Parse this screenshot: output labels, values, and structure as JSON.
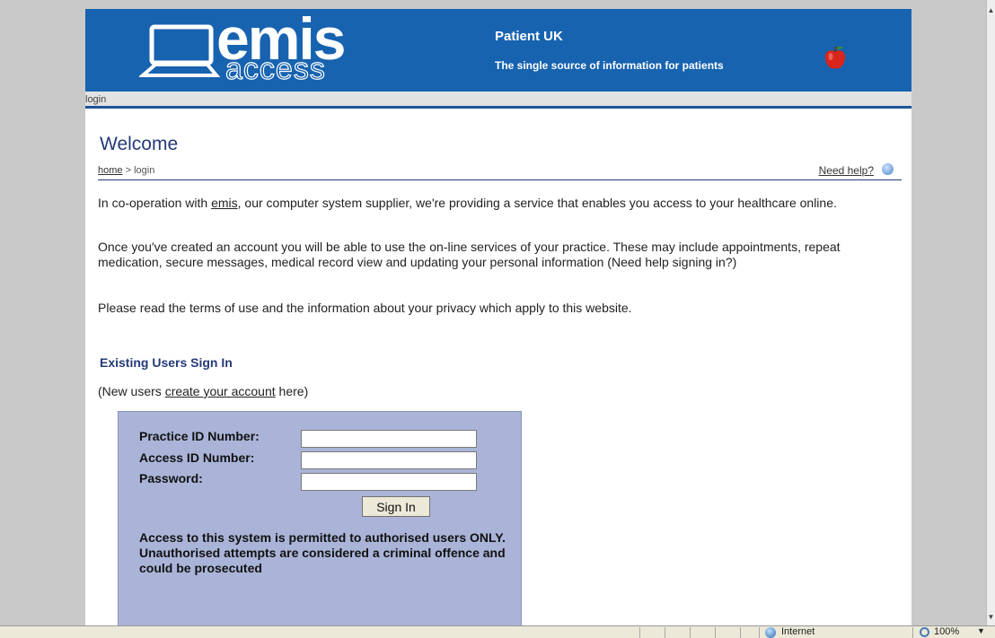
{
  "banner": {
    "logo_word": "emis",
    "logo_sub": "access",
    "site_name": "Patient UK",
    "tagline": "The single source of information for patients"
  },
  "navbar": {
    "label": "login"
  },
  "content": {
    "heading": "Welcome",
    "breadcrumb": {
      "home": "home",
      "sep": " > ",
      "current": "login"
    },
    "help_link": "Need help?",
    "para1": {
      "before": "In co-operation with ",
      "link": "emis",
      "after": ", our computer system supplier, we're providing a service that enables you access to your healthcare online."
    },
    "para2": "Once you've created an account you will be able to use the on-line services of your practice. These may include appointments, repeat medication, secure messages, medical record view and updating your personal information (Need help signing in?)",
    "para3": "Please read the terms of use and the information about your privacy which apply to this website.",
    "section_title": "Existing Users Sign In",
    "new_users": {
      "before": "(New users ",
      "link": "create your account",
      "after": " here)"
    }
  },
  "login_form": {
    "practice_id_label": "Practice ID Number:",
    "access_id_label": "Access ID Number:",
    "password_label": "Password:",
    "practice_id_value": "",
    "access_id_value": "",
    "password_value": "",
    "sign_in": "Sign In",
    "warning": "Access to this system is permitted to authorised users ONLY. Unauthorised attempts are considered a criminal offence and could be prosecuted"
  },
  "statusbar": {
    "zone": "Internet",
    "zoom": "100%"
  },
  "colors": {
    "banner_blue": "#1763b0",
    "heading_navy": "#253a78",
    "form_bg": "#aab4d8"
  }
}
